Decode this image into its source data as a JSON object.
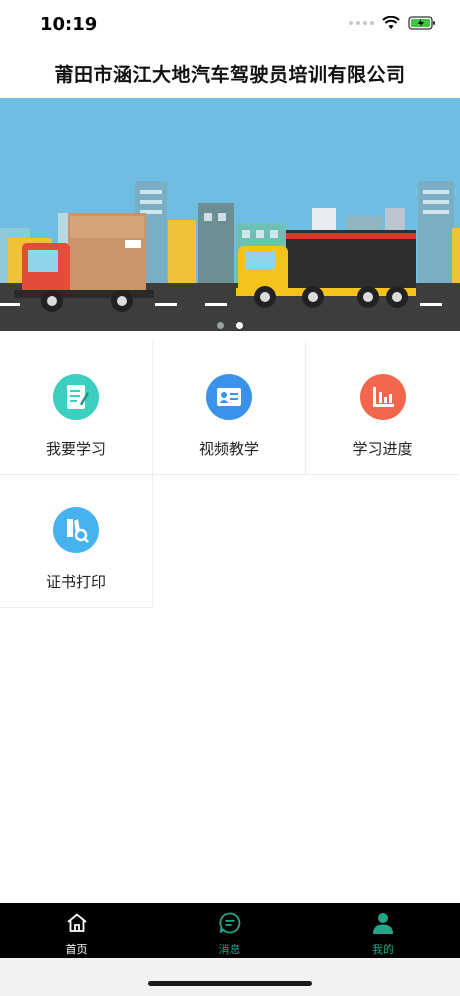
{
  "status": {
    "time": "10:19"
  },
  "header": {
    "title": "莆田市涵江大地汽车驾驶员培训有限公司"
  },
  "banner": {
    "slides": 2,
    "active_index": 1
  },
  "menu": {
    "items": [
      {
        "label": "我要学习",
        "icon": "notebook-icon",
        "color": "#3ccfbf"
      },
      {
        "label": "视频教学",
        "icon": "id-card-icon",
        "color": "#3a93ea"
      },
      {
        "label": "学习进度",
        "icon": "bar-chart-icon",
        "color": "#f2674c"
      },
      {
        "label": "证书打印",
        "icon": "certificate-search-icon",
        "color": "#46b2ee"
      }
    ]
  },
  "tabbar": {
    "items": [
      {
        "label": "首页",
        "icon": "home-icon",
        "color": "#ffffff"
      },
      {
        "label": "消息",
        "icon": "message-icon",
        "color": "#23a58a"
      },
      {
        "label": "我的",
        "icon": "user-icon",
        "color": "#23a58a"
      }
    ]
  },
  "colors": {
    "tabbar_bg": "#000000",
    "accent": "#23a58a"
  }
}
